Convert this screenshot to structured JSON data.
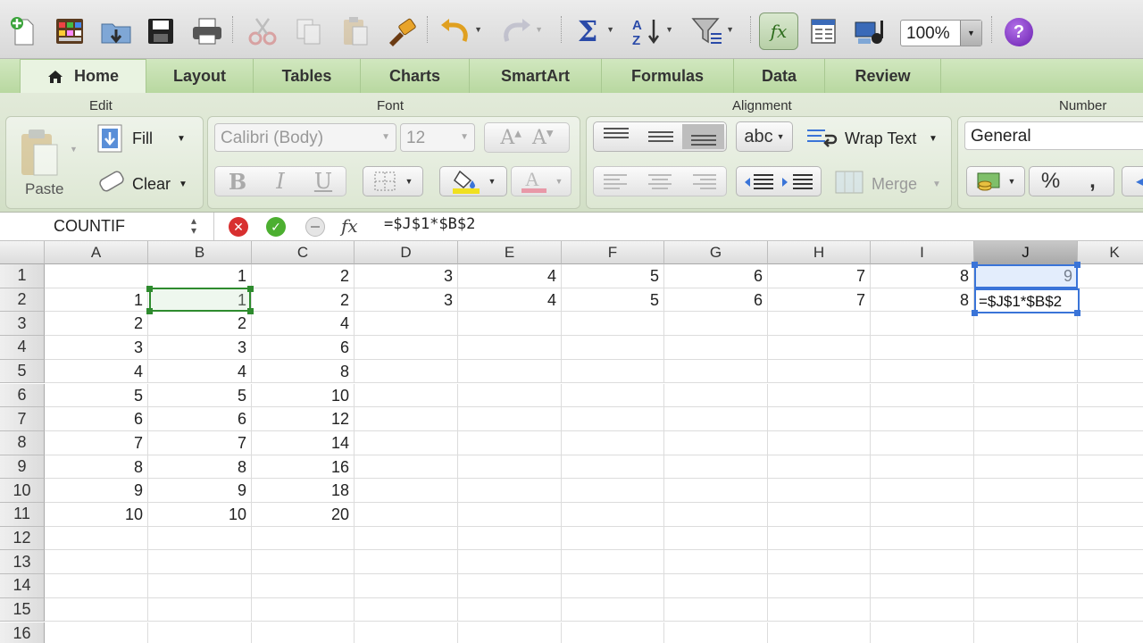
{
  "toolbar": {
    "zoom": "100%",
    "icons": [
      "new-workbook-icon",
      "template-gallery-icon",
      "open-icon",
      "save-icon",
      "print-icon",
      "cut-icon",
      "copy-icon",
      "paste-icon",
      "format-painter-icon",
      "undo-icon",
      "redo-icon",
      "autosum-icon",
      "sort-icon",
      "filter-icon",
      "formula-builder-icon",
      "toolbox-icon",
      "media-browser-icon",
      "zoom-select",
      "help-icon"
    ],
    "fx_label": "fx",
    "help_label": "?"
  },
  "tabs": [
    {
      "label": "Home",
      "active": true
    },
    {
      "label": "Layout",
      "active": false
    },
    {
      "label": "Tables",
      "active": false
    },
    {
      "label": "Charts",
      "active": false
    },
    {
      "label": "SmartArt",
      "active": false
    },
    {
      "label": "Formulas",
      "active": false
    },
    {
      "label": "Data",
      "active": false
    },
    {
      "label": "Review",
      "active": false
    }
  ],
  "ribbon": {
    "edit": {
      "title": "Edit",
      "paste": "Paste",
      "fill": "Fill",
      "clear": "Clear"
    },
    "font": {
      "title": "Font",
      "family": "Calibri (Body)",
      "size": "12",
      "bold": "B",
      "italic": "I",
      "underline": "U"
    },
    "alignment": {
      "title": "Alignment",
      "abc": "abc",
      "wrap": "Wrap Text",
      "merge": "Merge"
    },
    "number": {
      "title": "Number",
      "format": "General",
      "percent": "%",
      "comma": ","
    }
  },
  "formula_bar": {
    "name_box": "COUNTIF",
    "fx": "fx",
    "formula": "=$J$1*$B$2"
  },
  "grid": {
    "columns": [
      "A",
      "B",
      "C",
      "D",
      "E",
      "F",
      "G",
      "H",
      "I",
      "J",
      "K"
    ],
    "selected_column": "J",
    "rows": [
      [
        "",
        "1",
        "2",
        "3",
        "4",
        "5",
        "6",
        "7",
        "8",
        "9",
        ""
      ],
      [
        "1",
        "1",
        "2",
        "3",
        "4",
        "5",
        "6",
        "7",
        "8",
        "=$J$1*$B$2",
        ""
      ],
      [
        "2",
        "2",
        "4",
        "",
        "",
        "",
        "",
        "",
        "",
        "",
        ""
      ],
      [
        "3",
        "3",
        "6",
        "",
        "",
        "",
        "",
        "",
        "",
        "",
        ""
      ],
      [
        "4",
        "4",
        "8",
        "",
        "",
        "",
        "",
        "",
        "",
        "",
        ""
      ],
      [
        "5",
        "5",
        "10",
        "",
        "",
        "",
        "",
        "",
        "",
        "",
        ""
      ],
      [
        "6",
        "6",
        "12",
        "",
        "",
        "",
        "",
        "",
        "",
        "",
        ""
      ],
      [
        "7",
        "7",
        "14",
        "",
        "",
        "",
        "",
        "",
        "",
        "",
        ""
      ],
      [
        "8",
        "8",
        "16",
        "",
        "",
        "",
        "",
        "",
        "",
        "",
        ""
      ],
      [
        "9",
        "9",
        "18",
        "",
        "",
        "",
        "",
        "",
        "",
        "",
        ""
      ],
      [
        "10",
        "10",
        "20",
        "",
        "",
        "",
        "",
        "",
        "",
        "",
        ""
      ],
      [
        "",
        "",
        "",
        "",
        "",
        "",
        "",
        "",
        "",
        "",
        ""
      ],
      [
        "",
        "",
        "",
        "",
        "",
        "",
        "",
        "",
        "",
        "",
        ""
      ],
      [
        "",
        "",
        "",
        "",
        "",
        "",
        "",
        "",
        "",
        "",
        ""
      ],
      [
        "",
        "",
        "",
        "",
        "",
        "",
        "",
        "",
        "",
        "",
        ""
      ],
      [
        "",
        "",
        "",
        "",
        "",
        "",
        "",
        "",
        "",
        "",
        ""
      ]
    ]
  }
}
